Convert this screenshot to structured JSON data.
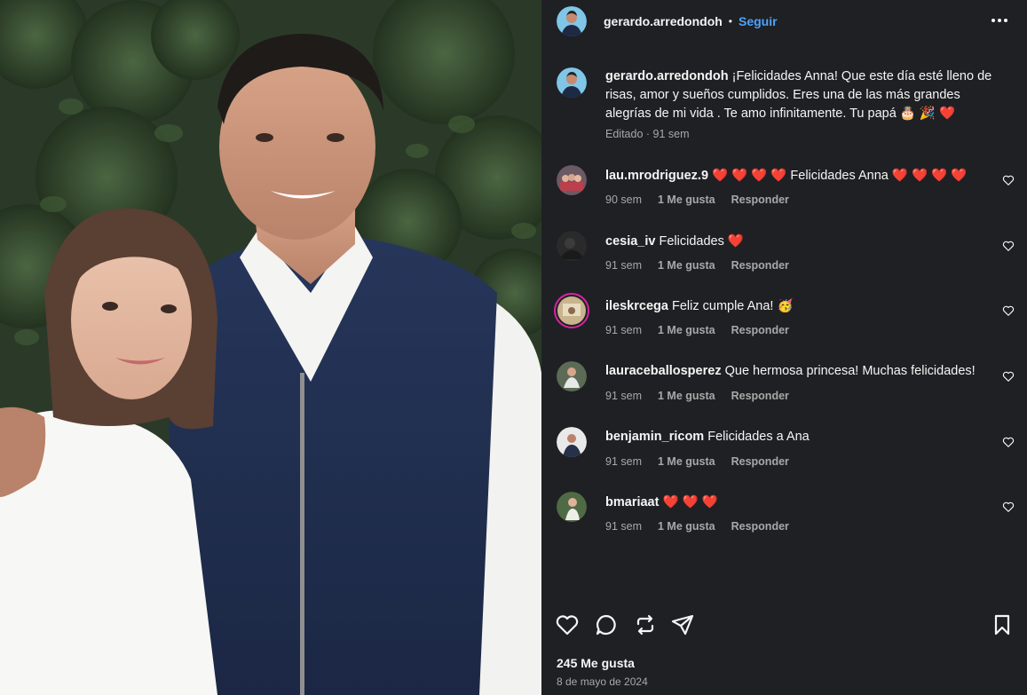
{
  "post": {
    "author": "gerardo.arredondoh",
    "separator": "•",
    "follow_label": "Seguir",
    "more_icon": "more-horizontal-icon",
    "caption_user": "gerardo.arredondoh",
    "caption_text": "¡Felicidades Anna! Que este día esté lleno de risas, amor y sueños cumplidos. Eres una de las más grandes alegrías de mi vida . Te amo infinitamente. Tu papá 🎂 🎉 ❤️",
    "caption_meta": "Editado · 91 sem",
    "likes": "245 Me gusta",
    "date": "8 de mayo de 2024"
  },
  "comments": [
    {
      "user": "lau.mrodriguez.9",
      "text": "❤️ ❤️ ❤️ ❤️  Felicidades Anna ❤️ ❤️ ❤️ ❤️",
      "time": "90 sem",
      "likes": "1 Me gusta",
      "reply": "Responder"
    },
    {
      "user": "cesia_iv",
      "text": "Felicidades  ❤️",
      "time": "91 sem",
      "likes": "1 Me gusta",
      "reply": "Responder"
    },
    {
      "user": "ileskrcega",
      "text": "Feliz cumple Ana!  🥳",
      "time": "91 sem",
      "likes": "1 Me gusta",
      "reply": "Responder"
    },
    {
      "user": "lauraceballosperez",
      "text": "Que hermosa princesa! Muchas felicidades!",
      "time": "91 sem",
      "likes": "1 Me gusta",
      "reply": "Responder"
    },
    {
      "user": "benjamin_ricom",
      "text": "Felicidades a Ana",
      "time": "91 sem",
      "likes": "1 Me gusta",
      "reply": "Responder"
    },
    {
      "user": "bmariaat",
      "text": "❤️ ❤️ ❤️",
      "time": "91 sem",
      "likes": "1 Me gusta",
      "reply": "Responder"
    }
  ],
  "actions": {
    "like_icon": "heart-icon",
    "comment_icon": "comment-icon",
    "repost_icon": "repost-icon",
    "share_icon": "send-icon",
    "save_icon": "bookmark-icon"
  },
  "colors": {
    "panel_bg": "#1f2024",
    "link_blue": "#4da3ff",
    "muted": "#a8a8a8",
    "heart_red": "#ff3040"
  }
}
